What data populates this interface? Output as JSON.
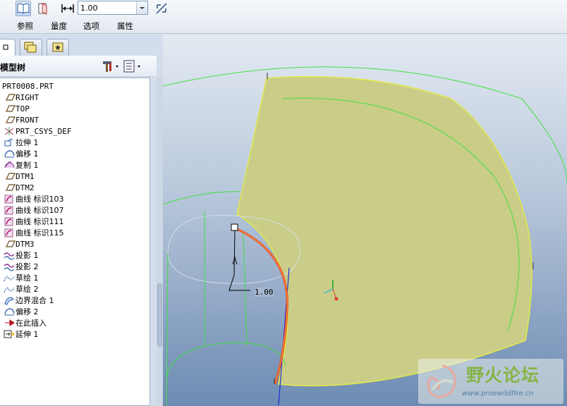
{
  "ribbon": {
    "length_value": "1.00",
    "tabs": [
      "参照",
      "量度",
      "选项",
      "属性"
    ]
  },
  "left_panel": {
    "tree_title": "模型树",
    "items": [
      {
        "label": "PRT0008.PRT",
        "icon": "part-icon"
      },
      {
        "label": "RIGHT",
        "icon": "datum-plane-icon"
      },
      {
        "label": "TOP",
        "icon": "datum-plane-icon"
      },
      {
        "label": "FRONT",
        "icon": "datum-plane-icon"
      },
      {
        "label": "PRT_CSYS_DEF",
        "icon": "coordinate-system-icon"
      },
      {
        "label": "拉伸 1",
        "icon": "extrude-icon"
      },
      {
        "label": "偏移 1",
        "icon": "offset-icon"
      },
      {
        "label": "复制 1",
        "icon": "copy-icon"
      },
      {
        "label": "DTM1",
        "icon": "datum-plane-icon"
      },
      {
        "label": "DTM2",
        "icon": "datum-plane-icon"
      },
      {
        "label": "曲线 标识103",
        "icon": "curve-icon"
      },
      {
        "label": "曲线 标识107",
        "icon": "curve-icon"
      },
      {
        "label": "曲线 标识111",
        "icon": "curve-icon"
      },
      {
        "label": "曲线 标识115",
        "icon": "curve-icon"
      },
      {
        "label": "DTM3",
        "icon": "datum-plane-icon"
      },
      {
        "label": "投影 1",
        "icon": "projection-icon"
      },
      {
        "label": "投影 2",
        "icon": "projection-icon"
      },
      {
        "label": "草绘 1",
        "icon": "sketch-icon"
      },
      {
        "label": "草绘 2",
        "icon": "sketch-icon"
      },
      {
        "label": "边界混合 1",
        "icon": "boundary-blend-icon"
      },
      {
        "label": "偏移 2",
        "icon": "offset-icon"
      },
      {
        "label": "在此插入",
        "icon": "insert-here-arrow-icon"
      },
      {
        "label": "延伸 1",
        "icon": "extend-icon"
      }
    ]
  },
  "viewport": {
    "dimension_label": "1.00"
  },
  "watermark": {
    "title": "野火论坛",
    "url": "www.proewildfire.cn"
  },
  "colors": {
    "surface_fill": "#c9cd88",
    "surface_edge": "#e3e94a",
    "edge_curve": "#e8411a",
    "wire": "#43e043",
    "accent_blue": "#1a2fd6"
  }
}
